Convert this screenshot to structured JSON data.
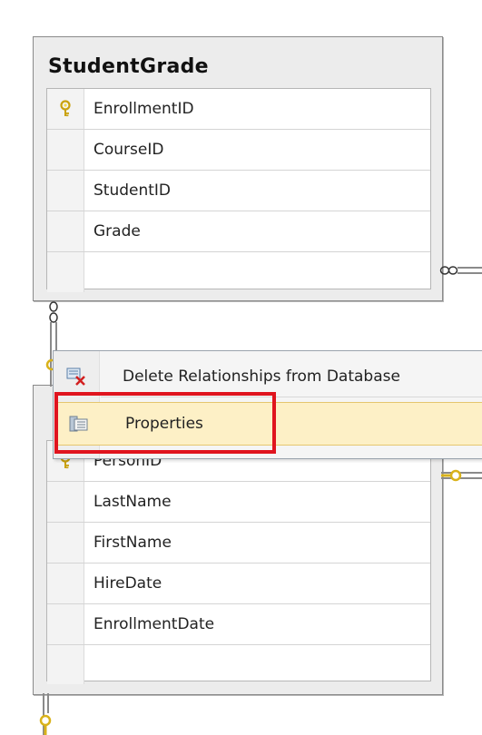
{
  "tables": {
    "student_grade": {
      "title": "StudentGrade",
      "columns": [
        {
          "name": "EnrollmentID",
          "primary_key": true
        },
        {
          "name": "CourseID",
          "primary_key": false
        },
        {
          "name": "StudentID",
          "primary_key": false
        },
        {
          "name": "Grade",
          "primary_key": false
        }
      ]
    },
    "person": {
      "columns": [
        {
          "name": "PersonID",
          "primary_key": true
        },
        {
          "name": "LastName",
          "primary_key": false
        },
        {
          "name": "FirstName",
          "primary_key": false
        },
        {
          "name": "HireDate",
          "primary_key": false
        },
        {
          "name": "EnrollmentDate",
          "primary_key": false
        }
      ]
    }
  },
  "context_menu": {
    "items": [
      {
        "label": "Delete Relationships from Database",
        "icon": "delete-relationship-icon",
        "hovered": false
      },
      {
        "label": "Properties",
        "icon": "properties-icon",
        "hovered": true
      }
    ]
  },
  "colors": {
    "key_gold": "#d9b21a",
    "highlight_red": "#e0141e",
    "hover_bg": "#fdf0c6"
  }
}
